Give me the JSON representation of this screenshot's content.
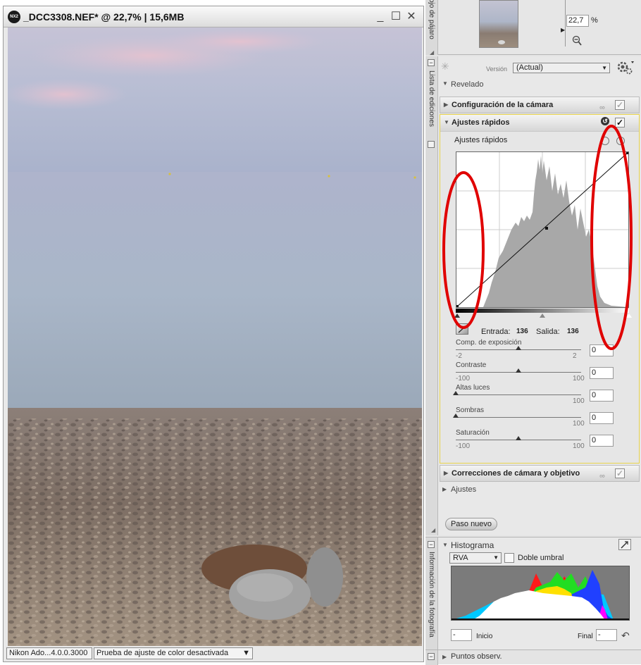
{
  "image_window": {
    "title": "_DCC3308.NEF* @ 22,7% | 15,6MB",
    "logo_text": "NX2",
    "controls": {
      "minimize": "_",
      "maximize": "☐",
      "close": "✕"
    },
    "status": {
      "app": "Nikon Ado...4.0.0.3000",
      "proof": "Prueba de ajuste de color desactivada"
    }
  },
  "birdseye": {
    "tab_label": "ojo de pájaro",
    "zoom_value": "22,7",
    "zoom_unit": "%"
  },
  "edit_list": {
    "tab_label": "Lista de ediciones",
    "version_label": "Versión",
    "version_value": "(Actual)",
    "revelado_label": "Revelado",
    "sections": {
      "camera_config": "Configuración de la cámara",
      "quick_adjust": "Ajustes rápidos",
      "corrections": "Correcciones de cámara y objetivo"
    },
    "quick_adjust": {
      "sub_label": "Ajustes rápidos",
      "entrada_label": "Entrada:",
      "entrada_value": "136",
      "salida_label": "Salida:",
      "salida_value": "136",
      "sliders": [
        {
          "label": "Comp. de exposición",
          "min": "-2",
          "max": "2",
          "value": "0",
          "level": 0.5
        },
        {
          "label": "Contraste",
          "min": "-100",
          "max": "100",
          "value": "0",
          "level": 0.5
        },
        {
          "label": "Altas luces",
          "min": "",
          "max": "100",
          "value": "0",
          "level": 0
        },
        {
          "label": "Sombras",
          "min": "",
          "max": "100",
          "value": "0",
          "level": 0
        },
        {
          "label": "Saturación",
          "min": "-100",
          "max": "100",
          "value": "0",
          "level": 0.5
        }
      ]
    },
    "ajustes_label": "Ajustes",
    "new_step_label": "Paso nuevo"
  },
  "photo_info": {
    "tab_label": "Información de la fotografía",
    "histogram_label": "Histograma",
    "channel_value": "RVA",
    "double_threshold_label": "Doble umbral",
    "start_label": "Inicio",
    "start_value": "-",
    "end_label": "Final",
    "end_value": "-",
    "control_points_label": "Puntos observ."
  },
  "colors": {
    "highlight_circle": "#e00000",
    "active_border": "#e8d34a"
  }
}
